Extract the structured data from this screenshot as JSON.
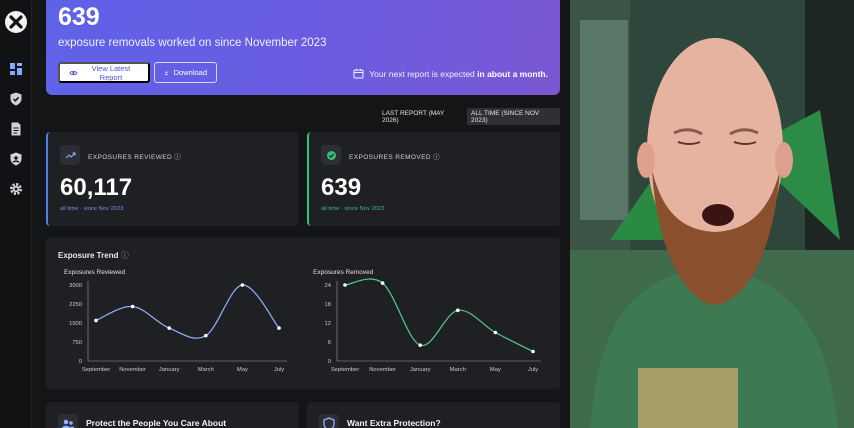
{
  "sidebar": {
    "items": [
      {
        "name": "dashboard-icon",
        "active": true
      },
      {
        "name": "shield-check-icon",
        "active": false
      },
      {
        "name": "document-icon",
        "active": false
      },
      {
        "name": "shield-user-icon",
        "active": false
      },
      {
        "name": "gear-icon",
        "active": false
      }
    ]
  },
  "banner": {
    "count": "639",
    "subtitle": "exposure removals worked on since November 2023",
    "view_label": "View Latest Report",
    "download_label": "Download",
    "next_report_prefix": "Your next report is expected",
    "next_report_time": "in about a month",
    "next_report_suffix": "."
  },
  "toggle": {
    "last_report": "LAST REPORT (MAY 2026)",
    "all_time": "ALL TIME (SINCE NOV 2023)"
  },
  "cards": {
    "reviewed": {
      "label": "EXPOSURES REVIEWED",
      "value": "60,117",
      "foot": "all time · since Nov 2023"
    },
    "removed": {
      "label": "EXPOSURES REMOVED",
      "value": "639",
      "foot": "all time · since Nov 2023"
    }
  },
  "trend": {
    "title": "Exposure Trend"
  },
  "colors": {
    "accent_blue": "#4a82e8",
    "accent_green": "#3bbf77",
    "line_blue": "#8fb3ff",
    "line_green": "#4ccf85"
  },
  "chart_data": [
    {
      "type": "line",
      "title": "Exposures Reviewed",
      "categories": [
        "September",
        "November",
        "January",
        "March",
        "May",
        "July"
      ],
      "x": [
        0,
        1,
        2,
        3,
        4,
        5,
        6,
        7,
        8,
        9,
        10,
        11
      ],
      "values": [
        1600,
        2150,
        1300,
        1000,
        3000,
        1300
      ],
      "yticks": [
        "3000",
        "2250",
        "1500",
        "750",
        "0"
      ],
      "ylim": [
        0,
        3000
      ],
      "color": "#8fb3ff"
    },
    {
      "type": "line",
      "title": "Exposures Removed",
      "categories": [
        "September",
        "November",
        "January",
        "March",
        "May",
        "July"
      ],
      "values": [
        24,
        24.6,
        5,
        16,
        9,
        3
      ],
      "yticks": [
        "24",
        "18",
        "12",
        "6",
        "0"
      ],
      "ylim": [
        0,
        24
      ],
      "color": "#4ccf85"
    }
  ],
  "bottom_cards": {
    "protect": "Protect the People You Care About",
    "extra": "Want Extra Protection?"
  }
}
